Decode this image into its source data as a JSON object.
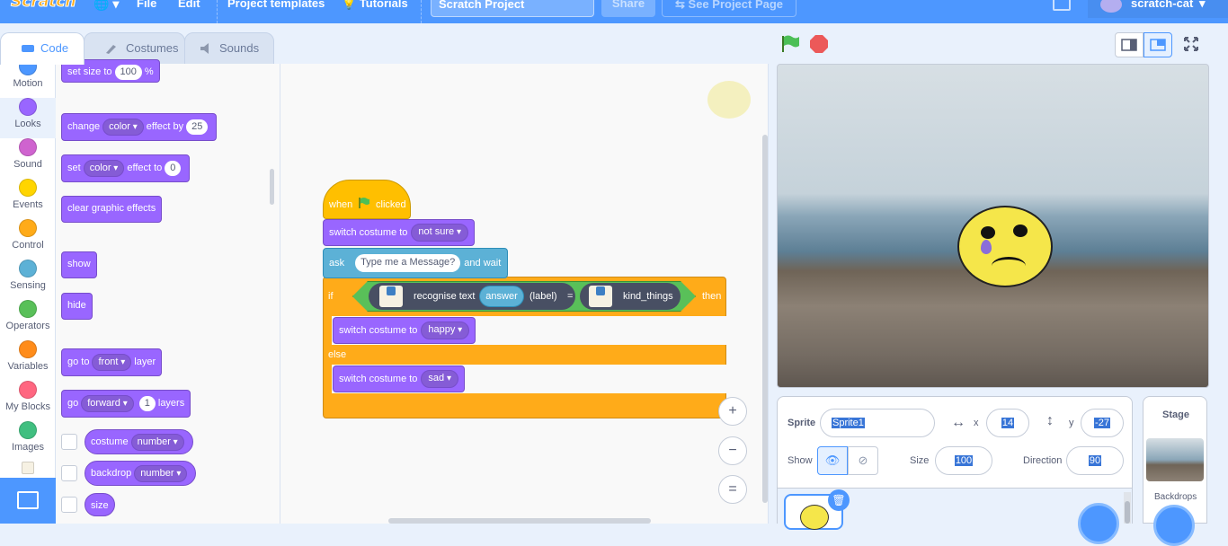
{
  "menubar": {
    "logo": "Scratch",
    "file": "File",
    "edit": "Edit",
    "project_templates": "Project templates",
    "tutorials": "Tutorials",
    "project_title": "Scratch Project",
    "share": "Share",
    "see_project_page": "See Project Page",
    "username": "scratch-cat"
  },
  "tabs": {
    "code": "Code",
    "costumes": "Costumes",
    "sounds": "Sounds"
  },
  "categories": [
    {
      "label": "Motion",
      "color": "#4c97ff"
    },
    {
      "label": "Looks",
      "color": "#9966ff"
    },
    {
      "label": "Sound",
      "color": "#cf63cf"
    },
    {
      "label": "Events",
      "color": "#ffd500"
    },
    {
      "label": "Control",
      "color": "#ffab19"
    },
    {
      "label": "Sensing",
      "color": "#5cb1d6"
    },
    {
      "label": "Operators",
      "color": "#59c059"
    },
    {
      "label": "Variables",
      "color": "#ff8c1a"
    },
    {
      "label": "My Blocks",
      "color": "#ff6680"
    },
    {
      "label": "Images",
      "color": "#40bf80"
    }
  ],
  "palette": {
    "set_size": {
      "pre": "set size to",
      "value": "100",
      "post": "%"
    },
    "change_effect": {
      "pre": "change",
      "effect": "color",
      "mid": "effect by",
      "value": "25"
    },
    "set_effect": {
      "pre": "set",
      "effect": "color",
      "mid": "effect to",
      "value": "0"
    },
    "clear_effects": "clear graphic effects",
    "show": "show",
    "hide": "hide",
    "go_to_layer": {
      "pre": "go to",
      "value": "front",
      "post": "layer"
    },
    "go_layers": {
      "pre": "go",
      "dir": "forward",
      "value": "1",
      "post": "layers"
    },
    "costume": {
      "label": "costume",
      "value": "number"
    },
    "backdrop": {
      "label": "backdrop",
      "value": "number"
    },
    "size": "size"
  },
  "script": {
    "when": "when",
    "clicked": "clicked",
    "switch_costume": "switch costume to",
    "costume_1": "not sure",
    "ask": "ask",
    "ask_text": "Type me a  Message?",
    "and_wait": "and wait",
    "if": "if",
    "recognise_text": "recognise text",
    "answer": "answer",
    "label": "(label)",
    "equals": "=",
    "kind_things": "kind_things",
    "then": "then",
    "costume_2": "happy",
    "else": "else",
    "costume_3": "sad"
  },
  "zoom": {
    "in": "+",
    "out": "−",
    "reset": "="
  },
  "sprite_info": {
    "sprite_label": "Sprite",
    "sprite_name": "Sprite1",
    "x_label": "x",
    "x_value": "14",
    "y_label": "y",
    "y_value": "-27",
    "show_label": "Show",
    "size_label": "Size",
    "size_value": "100",
    "direction_label": "Direction",
    "direction_value": "90"
  },
  "stage_panel": {
    "title": "Stage",
    "backdrops": "Backdrops"
  }
}
